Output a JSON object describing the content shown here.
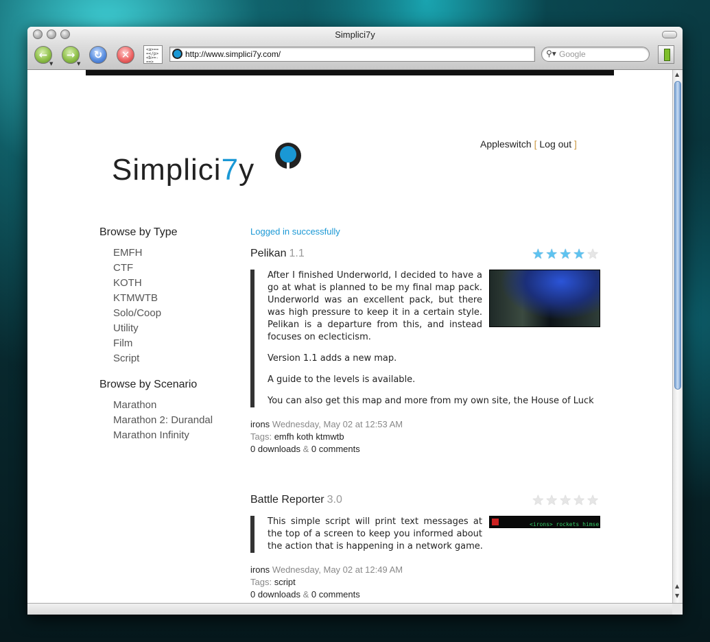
{
  "window": {
    "title": "Simplici7y"
  },
  "toolbar": {
    "url": "http://www.simplici7y.com/",
    "search_placeholder": "Google"
  },
  "site": {
    "logo_text_a": "Simplici",
    "logo_text_b": "7",
    "logo_text_c": "y",
    "user": "Appleswitch",
    "logout": "Log out",
    "bracket_open": "[",
    "bracket_close": "]",
    "brand_color": "#1a98d5"
  },
  "sidebar": {
    "type_heading": "Browse by Type",
    "types": [
      "EMFH",
      "CTF",
      "KOTH",
      "KTMWTB",
      "Solo/Coop",
      "Utility",
      "Film",
      "Script"
    ],
    "scenario_heading": "Browse by Scenario",
    "scenarios": [
      "Marathon",
      "Marathon 2: Durandal",
      "Marathon Infinity"
    ]
  },
  "main": {
    "notice": "Logged in successfully",
    "posts": [
      {
        "title": "Pelikan",
        "version": "1.1",
        "rating": 4,
        "paragraphs": [
          "After I finished Underworld, I decided to have a go at what is planned to be my final map pack. Underworld was an excellent pack, but there was high pressure to keep it in a certain style. Pelikan is a departure from this, and instead focuses on eclecticism.",
          "Version 1.1 adds a new map.",
          "A guide to the levels is available.",
          "You can also get this map and more from my own site, the House of Luck"
        ],
        "author": "irons",
        "date": "Wednesday, May 02 at 12:53 AM",
        "tags_label": "Tags:",
        "tags": "emfh koth ktmwtb",
        "downloads": "0 downloads",
        "comments": "0 comments"
      },
      {
        "title": "Battle Reporter",
        "version": "3.0",
        "rating": 0,
        "thumb_text": "<irons> rockets himself.",
        "paragraphs": [
          "This simple script will print text messages at the top of a screen to keep you informed about the action that is happening in a network game."
        ],
        "author": "irons",
        "date": "Wednesday, May 02 at 12:49 AM",
        "tags_label": "Tags:",
        "tags": "script",
        "downloads": "0 downloads",
        "comments": "0 comments"
      }
    ]
  }
}
